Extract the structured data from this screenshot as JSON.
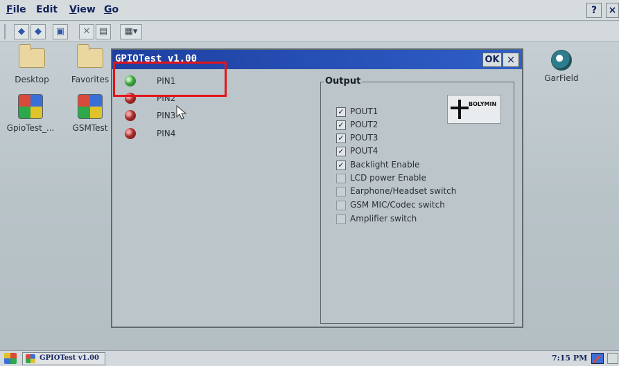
{
  "menubar": {
    "items": [
      {
        "first": "F",
        "rest": "ile",
        "accesskey_underlined": true
      },
      {
        "first": "Edit",
        "rest": "",
        "accesskey_underlined": false
      },
      {
        "first": "V",
        "rest": "iew",
        "accesskey_underlined": true
      },
      {
        "first": "G",
        "rest": "o",
        "accesskey_underlined": true
      }
    ],
    "help_label": "?",
    "close_label": "×"
  },
  "toolbar": {
    "buttons": [
      "back-icon",
      "forward-icon",
      "up-folder-icon",
      "delete-icon",
      "properties-icon",
      "view-menu-icon"
    ],
    "view_dropdown_glyph": "▾"
  },
  "desktop": {
    "icons": [
      {
        "label": "Desktop",
        "icon": "folder-icon"
      },
      {
        "label": "Favorites",
        "icon": "folder-icon"
      },
      {
        "label": "GpioTest_...",
        "icon": "app-icon"
      },
      {
        "label": "GSMTest",
        "icon": "app-icon"
      },
      {
        "label": "GarField",
        "icon": "media-icon"
      }
    ]
  },
  "dialog": {
    "title": "GPIOTest v1.00",
    "ok_label": "OK",
    "close_label": "×",
    "pins": [
      {
        "label": "PIN1",
        "state": "on"
      },
      {
        "label": "PIN2",
        "state": "off"
      },
      {
        "label": "PIN3",
        "state": "off"
      },
      {
        "label": "PIN4",
        "state": "off"
      }
    ],
    "output": {
      "title": "Output",
      "logo_text": "BOLYMIN",
      "checkboxes": [
        {
          "label": "POUT1",
          "checked": true
        },
        {
          "label": "POUT2",
          "checked": true
        },
        {
          "label": "POUT3",
          "checked": true
        },
        {
          "label": "POUT4",
          "checked": true
        },
        {
          "label": "Backlight Enable",
          "checked": true
        },
        {
          "label": "LCD power Enable",
          "checked": false
        },
        {
          "label": "Earphone/Headset switch",
          "checked": false
        },
        {
          "label": "GSM MIC/Codec switch",
          "checked": false
        },
        {
          "label": "Amplifier switch",
          "checked": false
        }
      ]
    }
  },
  "taskbar": {
    "task_title": "GPIOTest v1.00",
    "clock": "7:15 PM"
  },
  "colors": {
    "titlebar": "#1e3fa0",
    "led_on": "#3aa33f",
    "led_off": "#a52a2a",
    "highlight": "#e4141a"
  }
}
